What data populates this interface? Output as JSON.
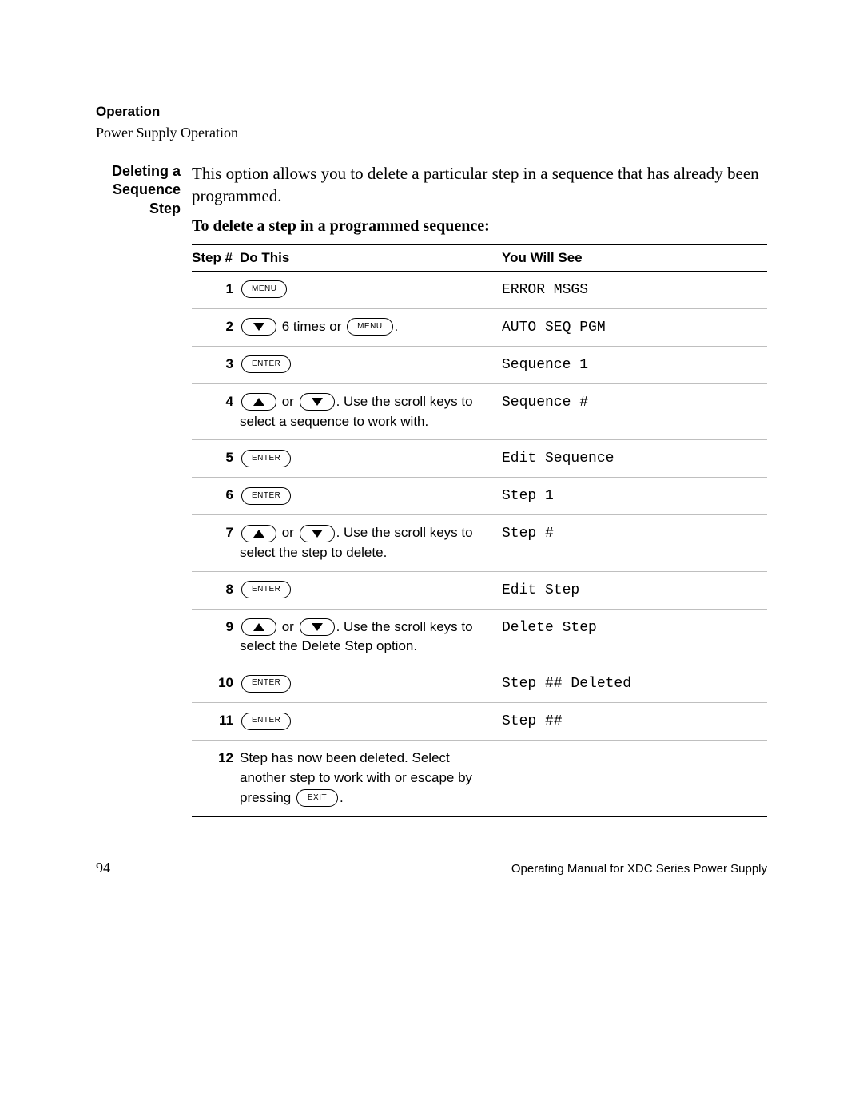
{
  "header": {
    "section": "Operation",
    "sub": "Power Supply Operation"
  },
  "side_label": {
    "l1": "Deleting a",
    "l2": "Sequence",
    "l3": "Step"
  },
  "intro": "This option allows you to delete a particular step in a sequence that has already been programmed.",
  "subtitle": "To delete a step in a programmed sequence:",
  "table": {
    "headers": {
      "step": "Step #",
      "do": "Do This",
      "see": "You Will See"
    },
    "buttons": {
      "menu": "MENU",
      "enter": "ENTER",
      "exit": "EXIT"
    },
    "text": {
      "r2_mid": " 6 times or ",
      "or": " or ",
      "r4_tail": ". Use the scroll keys to select a sequence to work with.",
      "r7_tail": ". Use the scroll keys to select the step to delete.",
      "r9_tail": ". Use the scroll keys to select the Delete Step option.",
      "r12_a": "Step has now been deleted. Select another step to work with or escape by pressing ",
      "period": "."
    },
    "rows": [
      {
        "n": "1",
        "see": "ERROR MSGS"
      },
      {
        "n": "2",
        "see": "AUTO SEQ PGM"
      },
      {
        "n": "3",
        "see": "Sequence 1"
      },
      {
        "n": "4",
        "see": "Sequence #"
      },
      {
        "n": "5",
        "see": "Edit Sequence"
      },
      {
        "n": "6",
        "see": "Step 1"
      },
      {
        "n": "7",
        "see": "Step #"
      },
      {
        "n": "8",
        "see": "Edit Step"
      },
      {
        "n": "9",
        "see": "Delete Step"
      },
      {
        "n": "10",
        "see": "Step ## Deleted"
      },
      {
        "n": "11",
        "see": "Step ##"
      },
      {
        "n": "12",
        "see": ""
      }
    ]
  },
  "footer": {
    "page": "94",
    "manual": "Operating Manual for XDC Series Power Supply"
  }
}
